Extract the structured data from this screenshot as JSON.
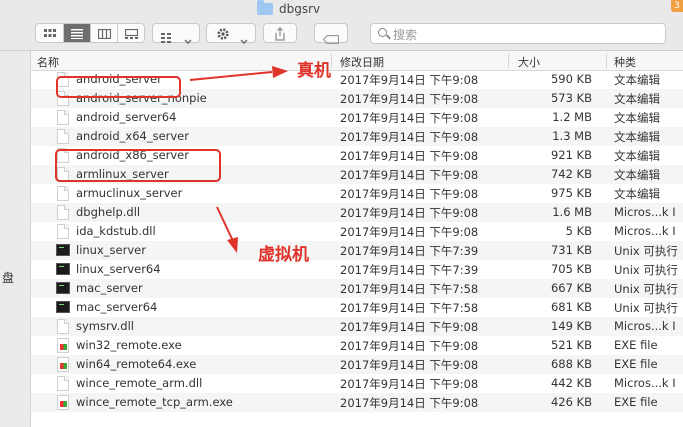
{
  "window": {
    "title": "dbgsrv",
    "badge": "3"
  },
  "toolbar": {
    "search_placeholder": "搜索"
  },
  "sidebar": {
    "partial_label": "盘"
  },
  "columns": {
    "name": "名称",
    "date": "修改日期",
    "size": "大小",
    "kind": "种类"
  },
  "files": [
    {
      "name": "android_server",
      "date": "2017年9月14日 下午9:08",
      "size": "590 KB",
      "kind": "文本编辑",
      "icon": "document"
    },
    {
      "name": "android_server_nonpie",
      "date": "2017年9月14日 下午9:08",
      "size": "573 KB",
      "kind": "文本编辑",
      "icon": "document"
    },
    {
      "name": "android_server64",
      "date": "2017年9月14日 下午9:08",
      "size": "1.2 MB",
      "kind": "文本编辑",
      "icon": "document"
    },
    {
      "name": "android_x64_server",
      "date": "2017年9月14日 下午9:08",
      "size": "1.3 MB",
      "kind": "文本编辑",
      "icon": "document"
    },
    {
      "name": "android_x86_server",
      "date": "2017年9月14日 下午9:08",
      "size": "921 KB",
      "kind": "文本编辑",
      "icon": "document"
    },
    {
      "name": "armlinux_server",
      "date": "2017年9月14日 下午9:08",
      "size": "742 KB",
      "kind": "文本编辑",
      "icon": "document"
    },
    {
      "name": "armuclinux_server",
      "date": "2017年9月14日 下午9:08",
      "size": "975 KB",
      "kind": "文本编辑",
      "icon": "document"
    },
    {
      "name": "dbghelp.dll",
      "date": "2017年9月14日 下午9:08",
      "size": "1.6 MB",
      "kind": "Micros...k I",
      "icon": "document"
    },
    {
      "name": "ida_kdstub.dll",
      "date": "2017年9月14日 下午9:08",
      "size": "5 KB",
      "kind": "Micros...k I",
      "icon": "document"
    },
    {
      "name": "linux_server",
      "date": "2017年9月14日 下午7:39",
      "size": "731 KB",
      "kind": "Unix 可执行",
      "icon": "executable"
    },
    {
      "name": "linux_server64",
      "date": "2017年9月14日 下午7:39",
      "size": "705 KB",
      "kind": "Unix 可执行",
      "icon": "executable"
    },
    {
      "name": "mac_server",
      "date": "2017年9月14日 下午7:58",
      "size": "667 KB",
      "kind": "Unix 可执行",
      "icon": "executable"
    },
    {
      "name": "mac_server64",
      "date": "2017年9月14日 下午7:58",
      "size": "681 KB",
      "kind": "Unix 可执行",
      "icon": "executable"
    },
    {
      "name": "symsrv.dll",
      "date": "2017年9月14日 下午9:08",
      "size": "149 KB",
      "kind": "Micros...k I",
      "icon": "document"
    },
    {
      "name": "win32_remote.exe",
      "date": "2017年9月14日 下午9:08",
      "size": "521 KB",
      "kind": "EXE file",
      "icon": "exe"
    },
    {
      "name": "win64_remote64.exe",
      "date": "2017年9月14日 下午9:08",
      "size": "688 KB",
      "kind": "EXE file",
      "icon": "exe"
    },
    {
      "name": "wince_remote_arm.dll",
      "date": "2017年9月14日 下午9:08",
      "size": "442 KB",
      "kind": "Micros...k I",
      "icon": "document"
    },
    {
      "name": "wince_remote_tcp_arm.exe",
      "date": "2017年9月14日 下午9:08",
      "size": "426 KB",
      "kind": "EXE file",
      "icon": "exe"
    }
  ],
  "annotations": {
    "real_device": "真机",
    "emulator": "虚拟机",
    "color": "#e0332a"
  }
}
